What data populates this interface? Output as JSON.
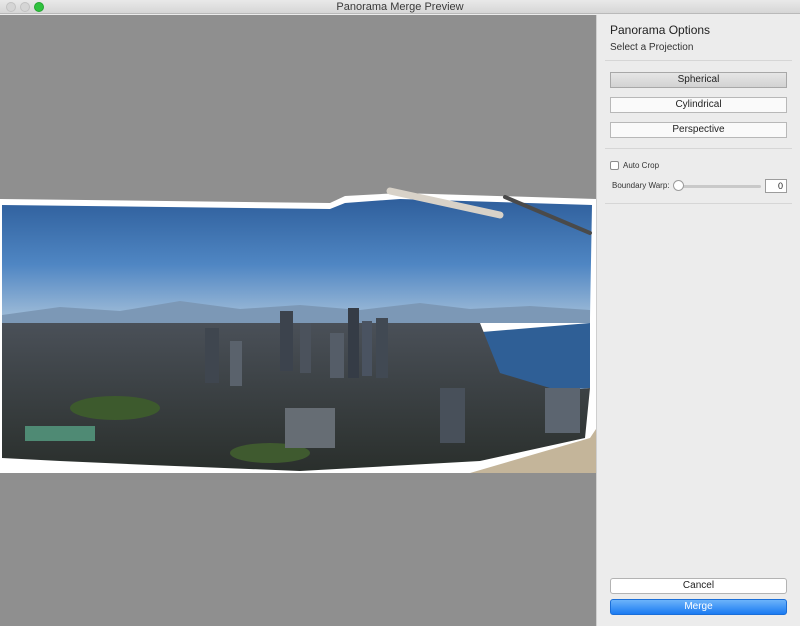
{
  "window": {
    "title": "Panorama Merge Preview"
  },
  "panel": {
    "title": "Panorama Options",
    "subtitle": "Select a Projection",
    "projections": [
      "Spherical",
      "Cylindrical",
      "Perspective"
    ],
    "selected_projection": "Spherical",
    "auto_crop": {
      "label": "Auto Crop",
      "checked": false
    },
    "boundary_warp": {
      "label": "Boundary Warp:",
      "value": "0",
      "level": 0
    }
  },
  "actions": {
    "cancel_label": "Cancel",
    "merge_label": "Merge"
  },
  "colors": {
    "preview_bg": "#8f8f8f",
    "panel_bg": "#ececec",
    "accent": "#1b7bf2",
    "zoom_button": "#2fc23e"
  }
}
